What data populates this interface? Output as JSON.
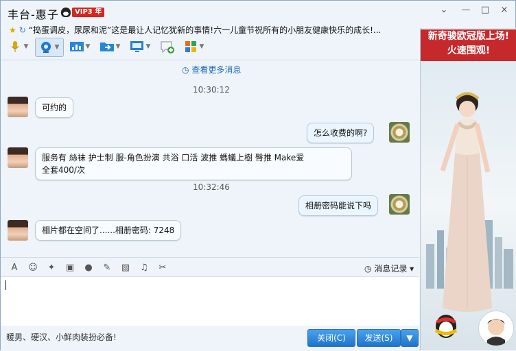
{
  "window": {
    "title": "丰台-惠子",
    "vip_badge": "VIP3 年",
    "signature": "“捣蛋调皮，尿尿和泥”这是最让人记忆犹新的事情!六一儿童节祝所有的小朋友健康快乐的成长!..."
  },
  "window_controls": [
    "chevron-down-icon",
    "minimize-icon",
    "maximize-icon",
    "close-icon"
  ],
  "toolbar": {
    "tools": [
      {
        "name": "voice-call",
        "icon": "microphone-icon",
        "color": "#e0a400"
      },
      {
        "name": "video-call",
        "icon": "webcam-icon",
        "color": "#1f78d1"
      },
      {
        "name": "remote-assist",
        "icon": "chart-icon",
        "color": "#2b86d9"
      },
      {
        "name": "transfer-file",
        "icon": "folder-arrow-icon",
        "color": "#2388d8"
      },
      {
        "name": "share-screen",
        "icon": "monitor-icon",
        "color": "#2a7fd0"
      },
      {
        "name": "create-discussion",
        "icon": "chat-add-icon",
        "color": "#35a23b"
      },
      {
        "name": "apps",
        "icon": "apps-grid-icon",
        "color": "#f06b19"
      }
    ]
  },
  "chat": {
    "more_messages": "查看更多消息",
    "messages": [
      {
        "type": "time",
        "text": "10:30:12"
      },
      {
        "side": "left",
        "text": "可约的"
      },
      {
        "side": "right",
        "text": "怎么收费的啊?"
      },
      {
        "side": "left",
        "text": "服务有 絲袜 护士制 服-角色扮演 共浴 口活 波推 螞蟻上樹 臀推 Make爱\n 全套400/次"
      },
      {
        "type": "time",
        "text": "10:32:46"
      },
      {
        "side": "right",
        "text": "相册密码能说下吗"
      },
      {
        "side": "left",
        "text": "相片都在空间了......相册密码: 7248"
      }
    ]
  },
  "input_toolbar": {
    "icons": [
      "font-icon",
      "emoji-icon",
      "shake-icon",
      "gif-icon",
      "voice-message-icon",
      "edit-icon",
      "image-icon",
      "music-icon",
      "scissors-icon"
    ],
    "history": "消息记录"
  },
  "bottom": {
    "ad_text": "暖男、硬汉、小鲜肉装扮必备!",
    "close_label": "关闭(C)",
    "send_label": "发送(S)"
  },
  "advertisement": {
    "line1": "新奇骏欧冠版上场!",
    "line2": "火速围观!"
  }
}
